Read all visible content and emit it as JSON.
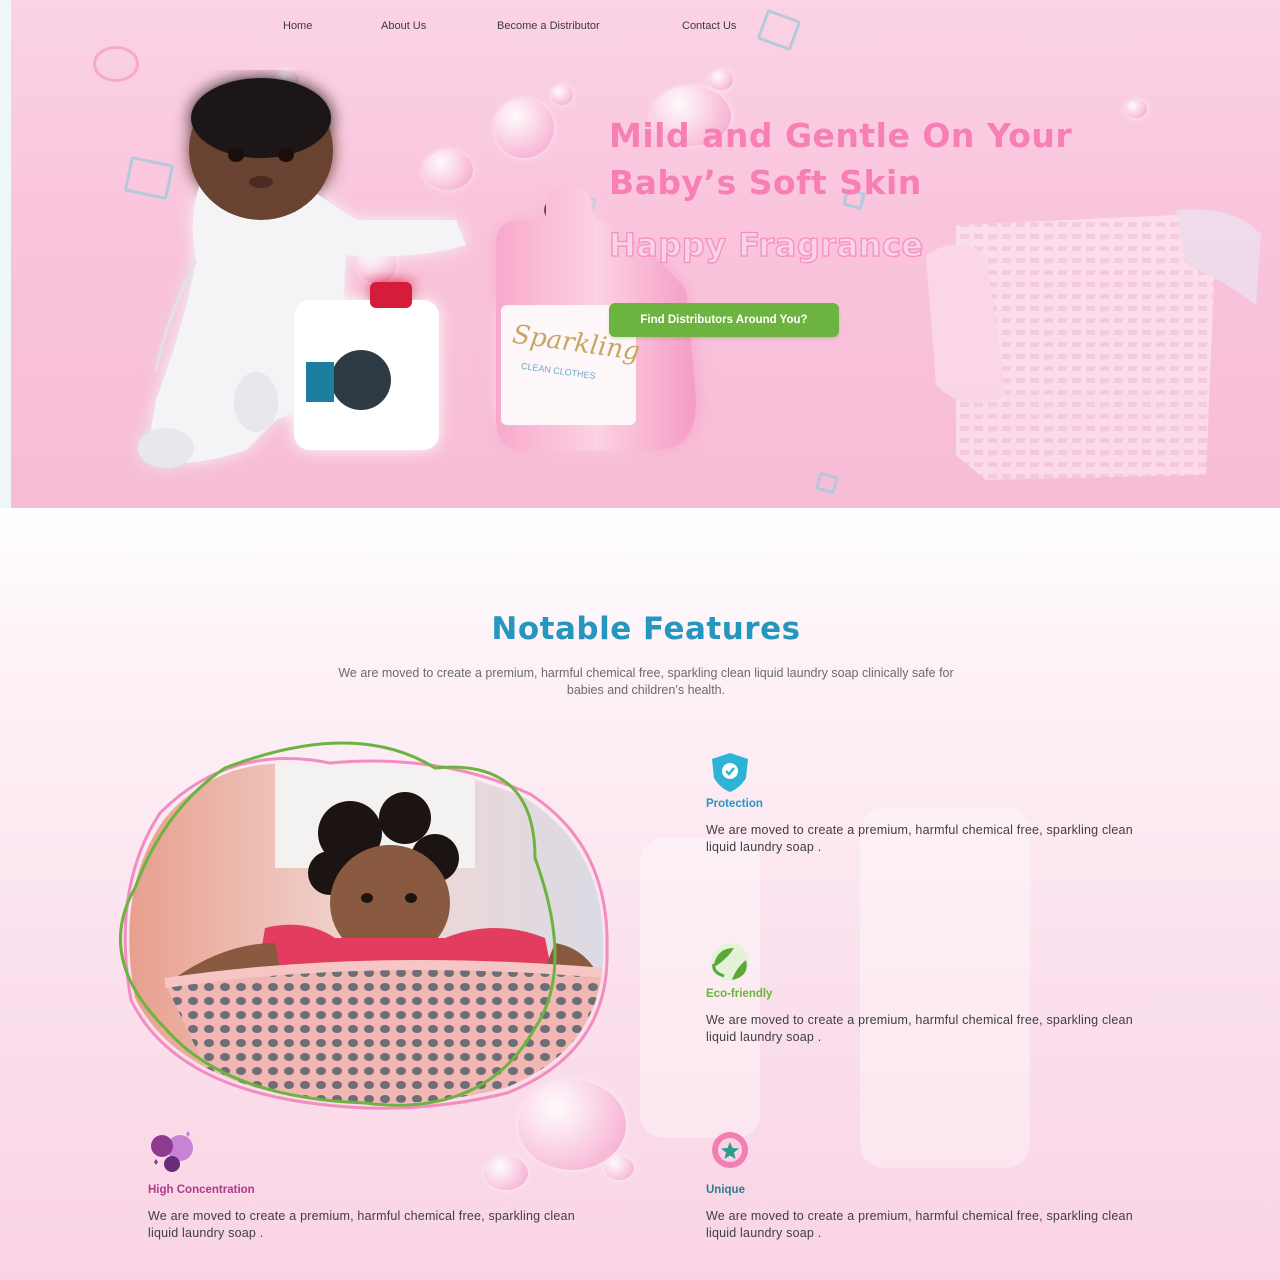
{
  "nav": {
    "items": [
      "Home",
      "About Us",
      "Become a Distributor",
      "Contact Us"
    ]
  },
  "hero": {
    "title_line1": "Mild and Gentle On Your",
    "title_line2": "Baby’s Soft Skin",
    "subtitle": "Happy Fragrance",
    "cta_label": "Find Distributors Around You?",
    "product_label": "Sparkling",
    "product_sublabel": "CLEAN CLOTHES"
  },
  "features": {
    "title": "Notable Features",
    "description": "We are moved to create a premium, harmful chemical free, sparkling clean liquid laundry soap clinically safe for babies and children’s health.",
    "items": [
      {
        "icon": "shield-check-icon",
        "label": "Protection",
        "color": "#2596be",
        "text": "We are moved to create a premium, harmful chemical free, sparkling clean liquid laundry soap ."
      },
      {
        "icon": "recycle-leaf-icon",
        "label": "Eco-friendly",
        "color": "#6cb33f",
        "text": "We are moved to create a premium, harmful chemical free, sparkling clean liquid laundry soap ."
      },
      {
        "icon": "bubbles-icon",
        "label": "High Concentration",
        "color": "#b03a8a",
        "text": "We are moved to create a premium, harmful chemical free, sparkling clean liquid laundry soap ."
      },
      {
        "icon": "star-badge-icon",
        "label": "Unique",
        "color": "#2a7f8e",
        "text": "We are moved to create a premium, harmful chemical free, sparkling clean liquid laundry soap ."
      }
    ]
  },
  "colors": {
    "brand_pink": "#f77fb4",
    "cta_green": "#6cb33f",
    "title_blue": "#2596be"
  }
}
